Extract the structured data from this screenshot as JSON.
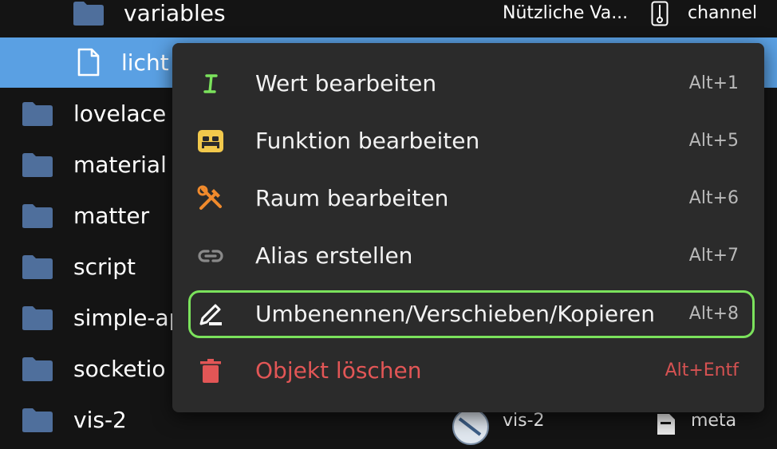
{
  "tree": {
    "rows": [
      {
        "label": "variables",
        "name": "Nützliche Va...",
        "type": "channel"
      },
      {
        "label": "licht"
      },
      {
        "label": "lovelace"
      },
      {
        "label": "material"
      },
      {
        "label": "matter"
      },
      {
        "label": "script"
      },
      {
        "label": "simple-ap"
      },
      {
        "label": "socketio"
      },
      {
        "label": "vis-2",
        "name": "vis-2",
        "type": "meta"
      }
    ]
  },
  "context_menu": {
    "items": [
      {
        "label": "Wert bearbeiten",
        "shortcut": "Alt+1",
        "icon": "text-cursor-icon",
        "color": "#7be25c"
      },
      {
        "label": "Funktion bearbeiten",
        "shortcut": "Alt+5",
        "icon": "bed-icon",
        "color": "#f2c94c"
      },
      {
        "label": "Raum bearbeiten",
        "shortcut": "Alt+6",
        "icon": "tools-icon",
        "color": "#f08a2c"
      },
      {
        "label": "Alias erstellen",
        "shortcut": "Alt+7",
        "icon": "link-icon",
        "color": "#8a8a8a"
      },
      {
        "label": "Umbenennen/Verschieben/Kopieren",
        "shortcut": "Alt+8",
        "icon": "rename-icon",
        "color": "#ffffff"
      },
      {
        "label": "Objekt löschen",
        "shortcut": "Alt+Entf",
        "icon": "trash-icon",
        "color": "#e25656"
      }
    ]
  },
  "colors": {
    "background": "#141414",
    "selected_row": "#5aa0e3",
    "folder": "#4f6f9c",
    "menu_bg": "#2b2b2b",
    "highlight_border": "#7be25c",
    "danger": "#e25656"
  }
}
